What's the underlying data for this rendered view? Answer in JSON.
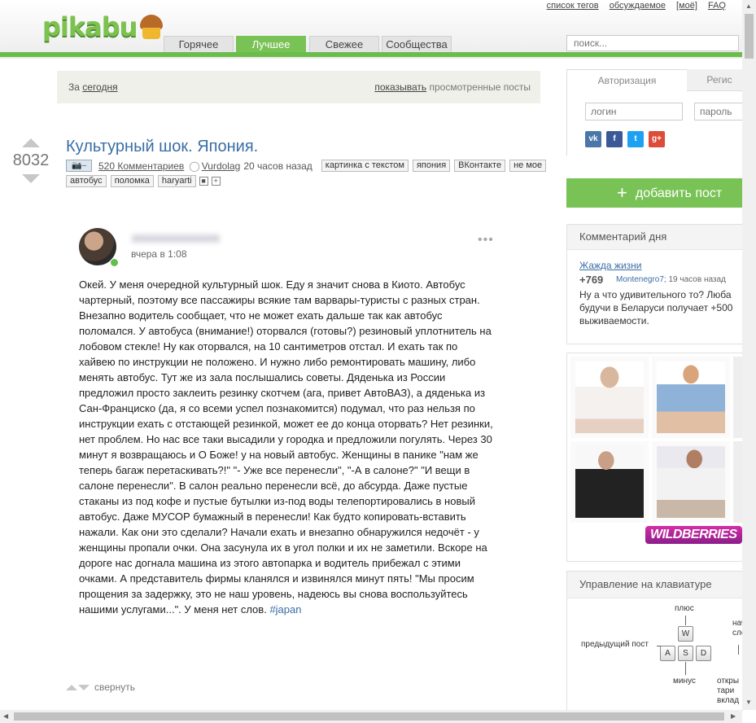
{
  "header": {
    "logo_text": "pikabu",
    "top_links": [
      "список тегов",
      "обсуждаемое",
      "[моё]",
      "FAQ"
    ],
    "nav_tabs": [
      {
        "label": "Горячее",
        "active": false
      },
      {
        "label": "Лучшее",
        "active": true
      },
      {
        "label": "Свежее",
        "active": false
      },
      {
        "label": "Сообщества",
        "active": false
      }
    ],
    "search_placeholder": "поиск..."
  },
  "filter": {
    "prefix": "За",
    "period": "сегодня",
    "show_link": "показывать",
    "viewed": "просмотренные посты"
  },
  "post": {
    "rating": "8032",
    "title": "Культурный шок. Япония.",
    "camera_badge": "–",
    "comments": "520 Комментариев",
    "author": "Vurdolag",
    "time_ago": "20 часов назад",
    "tags_row1": [
      "картинка с текстом",
      "япония",
      "ВКонтакте",
      "не мое"
    ],
    "tags_row2": [
      "автобус",
      "поломка",
      "haryarti"
    ],
    "collapse_label": "свернуть"
  },
  "embedded": {
    "time": "вчера в 1:08",
    "more": "•••",
    "text": "Окей. У меня очередной культурный шок. Еду я значит снова в Киото. Автобус чартерный, поэтому все пассажиры всякие там варвары-туристы с разных стран. Внезапно водитель сообщает, что не может ехать дальше так как автобус поломался. У автобуса (внимание!) оторвался (готовы?) резиновый уплотнитель на лобовом стекле! Ну как оторвался, на 10 сантиметров отстал. И ехать так по хайвею по инструкции не положено. И нужно либо ремонтировать машину, либо менять автобус. Тут же из зала послышались советы. Дяденька из России предложил просто заклеить резинку скотчем (ага, привет АвтоВАЗ), а дяденька из Сан-Франциско (да, я со всеми успел познакомится) подумал, что раз нельзя по инструкции ехать с отстающей резинкой, может ее до конца оторвать? Нет резинки, нет проблем. Но нас все таки высадили у городка и предложили погулять. Через 30 минут я возвращаюсь и О Боже! у на новый автобус. Женщины в панике \"нам же теперь багаж перетаскивать?!\" \"- Уже все перенесли\", \"-А в салоне?\" \"И вещи в салоне перенесли\". В салон реально перенесли всё, до абсурда. Даже пустые стаканы из под кофе и пустые бутылки из-под воды телепортировались в новый автобус. Даже МУСОР бумажный в перенесли! Как будто копировать-вставить нажали. Как они это сделали? Начали ехать и внезапно обнаружился недочёт - у женщины пропали очки. Она засунула их в угол полки и их не заметили. Вскоре на дороге нас догнала машина из этого автопарка и водитель прибежал с этими очками. А представитель фирмы кланялся и извинялся минут пять! \"Мы просим прощения за задержку, это не наш уровень, надеюсь вы снова воспользуйтесь нашими услугами...\". У меня нет слов.",
    "hashtag": "#japan"
  },
  "sidebar": {
    "auth_tabs": [
      "Авторизация",
      "Регис"
    ],
    "login_placeholder": "логин",
    "password_placeholder": "пароль",
    "social": [
      "vk",
      "f",
      "t",
      "g+"
    ],
    "add_post": "добавить пост",
    "cod_title": "Комментарий дня",
    "cod_link": "Жажда жизни",
    "cod_score": "+769",
    "cod_author": "Montenegro7;",
    "cod_ago": "19 часов назад",
    "cod_text": "Ну а что удивительного то? Люба будучи в Беларуси получает +500 выживаемости.",
    "ad_brand": "WILDBERRIES",
    "kbd_title": "Управление на клавиатуре",
    "kbd_labels": {
      "plus": "плюс",
      "start1": "начало к",
      "start2": "следую",
      "prev": "предыдущий пост",
      "minus": "минус",
      "open1": "откры",
      "open2": "тари",
      "open3": "вклад"
    },
    "keys": [
      "W",
      "A",
      "S",
      "D"
    ]
  },
  "colors": {
    "accent_green": "#79c256",
    "link_blue": "#3a6ea5"
  }
}
